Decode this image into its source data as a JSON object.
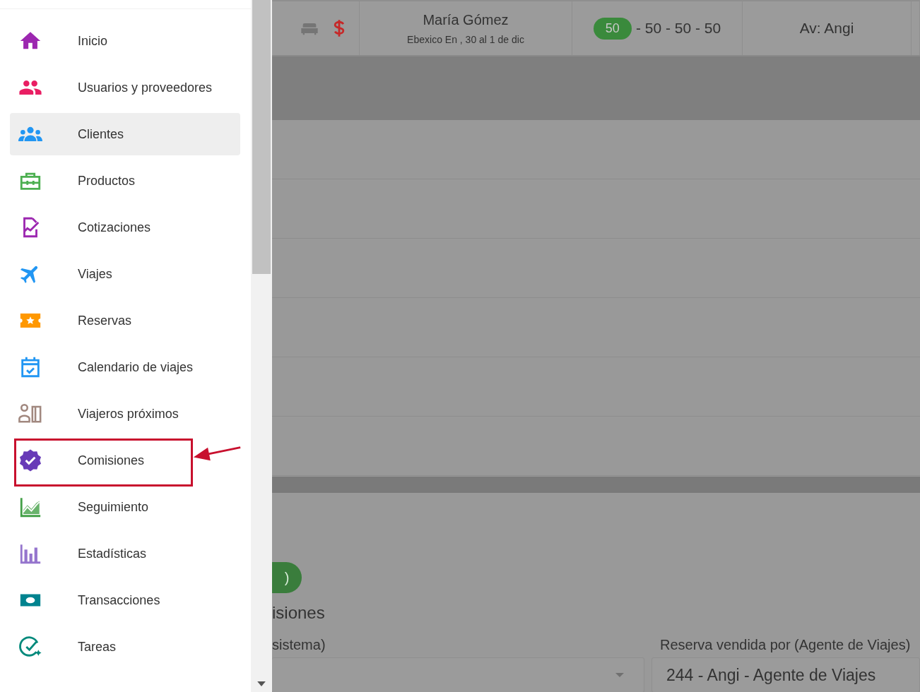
{
  "sidebar": {
    "items": [
      {
        "label": "Inicio",
        "selected": false,
        "annotated": false
      },
      {
        "label": "Usuarios y proveedores",
        "selected": false,
        "annotated": false
      },
      {
        "label": "Clientes",
        "selected": true,
        "annotated": false
      },
      {
        "label": "Productos",
        "selected": false,
        "annotated": false
      },
      {
        "label": "Cotizaciones",
        "selected": false,
        "annotated": false
      },
      {
        "label": "Viajes",
        "selected": false,
        "annotated": false
      },
      {
        "label": "Reservas",
        "selected": false,
        "annotated": false
      },
      {
        "label": "Calendario de viajes",
        "selected": false,
        "annotated": false
      },
      {
        "label": "Viajeros próximos",
        "selected": false,
        "annotated": false
      },
      {
        "label": "Comisiones",
        "selected": false,
        "annotated": true
      },
      {
        "label": "Seguimiento",
        "selected": false,
        "annotated": false
      },
      {
        "label": "Estadísticas",
        "selected": false,
        "annotated": false
      },
      {
        "label": "Transacciones",
        "selected": false,
        "annotated": false
      },
      {
        "label": "Tareas",
        "selected": false,
        "annotated": false
      }
    ]
  },
  "booking_row": {
    "client_name": "María Gómez",
    "trip": "Ebexico En , 30 al 1 de dic",
    "badge": "50",
    "amounts": "- 50 - 50 - 50",
    "agent": "Av: Angi"
  },
  "form": {
    "pill": ")",
    "section_title": "isiones",
    "fields": [
      {
        "label": "sistema)",
        "kind": "select"
      },
      {
        "label": "Reserva vendida por (Agente de Viajes)",
        "value": "244 - Angi - Agente de Viajes",
        "kind": "text"
      }
    ]
  }
}
